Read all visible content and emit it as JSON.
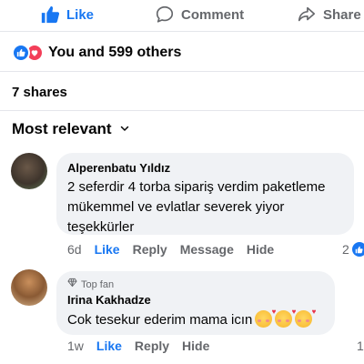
{
  "actions": {
    "like": "Like",
    "comment": "Comment",
    "share": "Share"
  },
  "reactions": {
    "summary": "You and 599 others",
    "icons": [
      "like-icon",
      "love-icon"
    ]
  },
  "shares": "7 shares",
  "sort": {
    "label": "Most relevant"
  },
  "comments": [
    {
      "author": "Alperenbatu Yıldız",
      "text": "2 seferdir 4 torba sipariş verdim paketleme mükemmel ve evlatlar severek yiyor teşekkürler",
      "time": "6d",
      "actions": [
        "Like",
        "Reply",
        "Message",
        "Hide"
      ],
      "reaction_count": "2"
    },
    {
      "badge": "Top fan",
      "author": "Irina Kakhadze",
      "text": "Cok tesekur ederim mama icın",
      "emojis": [
        "smiling-face-with-hearts",
        "smiling-face-with-hearts",
        "smiling-face-with-hearts"
      ],
      "time": "1w",
      "actions": [
        "Like",
        "Reply",
        "Hide"
      ],
      "reaction_count": "1"
    }
  ],
  "colors": {
    "brand_blue": "#1877f2",
    "love_red": "#f33e58",
    "muted": "#65676b",
    "bubble": "#f0f2f5"
  }
}
